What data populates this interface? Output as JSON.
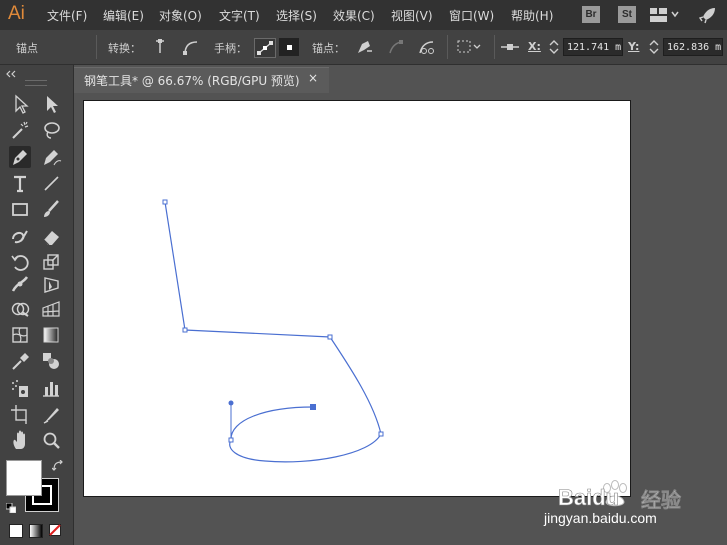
{
  "app": {
    "logo": "Ai"
  },
  "menu": [
    "文件(F)",
    "编辑(E)",
    "对象(O)",
    "文字(T)",
    "选择(S)",
    "效果(C)",
    "视图(V)",
    "窗口(W)",
    "帮助(H)"
  ],
  "menubar_right": {
    "bridge": "Br",
    "stock": "St"
  },
  "control": {
    "selection_label": "锚点",
    "convert_label": "转换：",
    "handles_label": "手柄：",
    "anchors_label": "锚点：",
    "x_label": "X:",
    "x_value": "121.741 m",
    "y_label": "Y:",
    "y_value": "162.836 m"
  },
  "document": {
    "tab_title": "钢笔工具* @ 66.67% (RGB/GPU 预览)",
    "close": "×"
  },
  "watermark": {
    "brand": "Baidu",
    "suffix": "经验",
    "url": "jingyan.baidu.com"
  },
  "colors": {
    "path": "#4a6fd1",
    "ui_bg": "#535353",
    "panel": "#424242",
    "menubar": "#323232"
  },
  "icons": [
    "selection-icon",
    "direct-selection-icon",
    "magic-wand-icon",
    "lasso-icon",
    "pen-icon",
    "curvature-icon",
    "type-icon",
    "line-icon",
    "rectangle-icon",
    "paintbrush-icon",
    "shaper-icon",
    "eraser-icon",
    "rotate-icon",
    "scale-icon",
    "width-icon",
    "free-transform-icon",
    "shape-builder-icon",
    "perspective-grid-icon",
    "mesh-icon",
    "gradient-icon",
    "eyedropper-icon",
    "blend-icon",
    "symbol-sprayer-icon",
    "column-graph-icon",
    "artboard-icon",
    "slice-icon",
    "hand-icon",
    "zoom-icon"
  ]
}
